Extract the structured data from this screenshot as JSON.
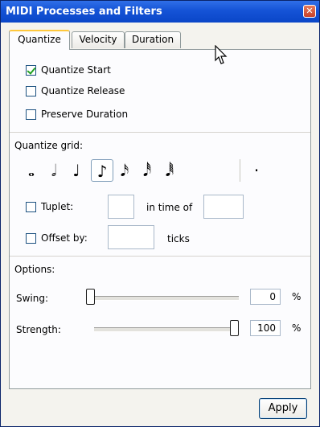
{
  "window": {
    "title": "MIDI Processes and Filters",
    "close_glyph": "✕"
  },
  "tabs": [
    {
      "label": "Quantize",
      "active": true
    },
    {
      "label": "Velocity",
      "active": false
    },
    {
      "label": "Duration",
      "active": false
    }
  ],
  "options_checks": [
    {
      "label": "Quantize Start",
      "checked": true
    },
    {
      "label": "Quantize Release",
      "checked": false
    },
    {
      "label": "Preserve Duration",
      "checked": false
    }
  ],
  "grid": {
    "heading": "Quantize grid:",
    "notes": [
      {
        "name": "whole-note-icon",
        "glyph": "𝅝"
      },
      {
        "name": "half-note-icon",
        "glyph": "𝅗𝅥"
      },
      {
        "name": "quarter-note-icon",
        "glyph": "♩"
      },
      {
        "name": "eighth-note-icon",
        "glyph": "♪"
      },
      {
        "name": "sixteenth-note-icon",
        "glyph": "𝅘𝅥𝅯"
      },
      {
        "name": "thirty-second-note-icon",
        "glyph": "𝅘𝅥𝅰"
      },
      {
        "name": "sixty-fourth-note-icon",
        "glyph": "𝅘𝅥𝅱"
      }
    ],
    "selected_note": "eighth-note-icon",
    "dot_glyph": "·",
    "tuplet_label": "Tuplet:",
    "tuplet_value": "",
    "in_time_of_label": "in time of",
    "in_time_of_value": "",
    "offset_label": "Offset by:",
    "offset_value": "",
    "ticks_label": "ticks"
  },
  "options": {
    "heading": "Options:",
    "swing_label": "Swing:",
    "swing_value": "0",
    "swing_level": 0,
    "strength_label": "Strength:",
    "strength_value": "100",
    "strength_level": 1,
    "percent": "%"
  },
  "apply_label": "Apply"
}
